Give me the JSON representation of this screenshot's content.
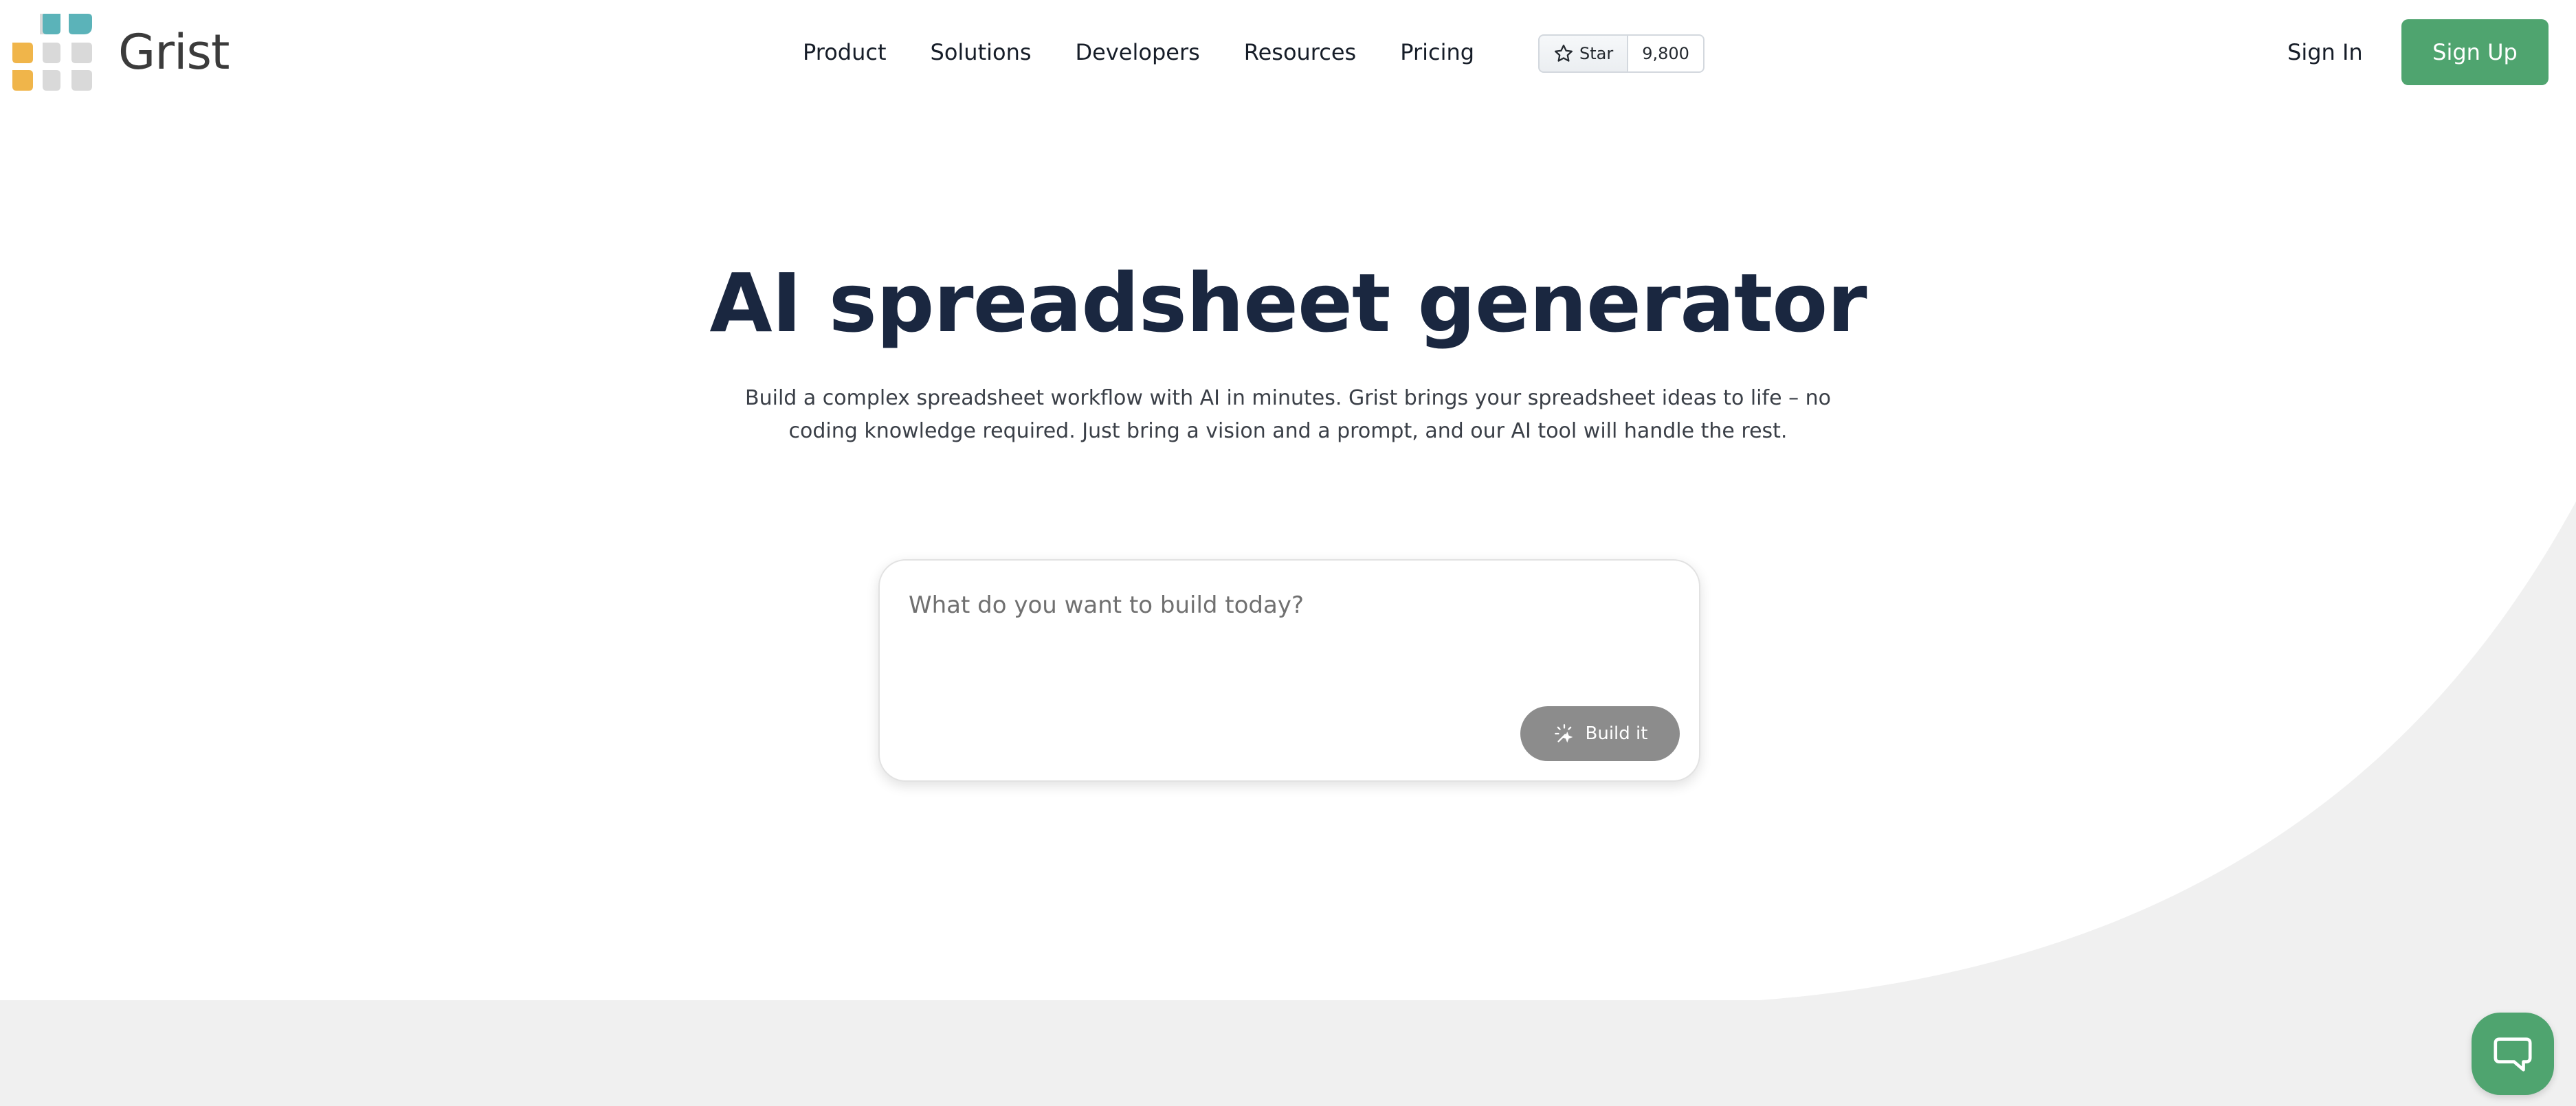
{
  "brand": {
    "name": "Grist",
    "logo_icon": "grist-logo-icon",
    "colors": {
      "teal": "#5bb3b9",
      "orange": "#f0b54a",
      "gray": "#d9d9d9",
      "accent_green": "#4fa46f"
    }
  },
  "nav": {
    "items": [
      {
        "label": "Product"
      },
      {
        "label": "Solutions"
      },
      {
        "label": "Developers"
      },
      {
        "label": "Resources"
      },
      {
        "label": "Pricing"
      }
    ]
  },
  "github": {
    "star_label": "Star",
    "star_count": "9,800",
    "icon": "star-icon"
  },
  "auth": {
    "signin_label": "Sign In",
    "signup_label": "Sign Up"
  },
  "hero": {
    "title": "AI spreadsheet generator",
    "subtitle": "Build a complex spreadsheet workflow with AI in minutes. Grist brings your spreadsheet ideas to life – no coding knowledge required. Just bring a vision and a prompt, and our AI tool will handle the rest."
  },
  "prompt": {
    "placeholder": "What do you want to build today?",
    "value": "",
    "build_label": "Build it",
    "build_icon": "sparkle-icon"
  },
  "support": {
    "chat_icon": "chat-icon"
  }
}
